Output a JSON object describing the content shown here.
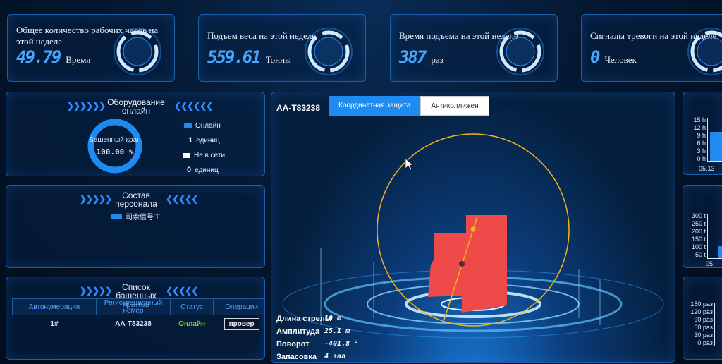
{
  "stats": [
    {
      "title": "Общее количество рабочих часов на этой неделе",
      "value": "49.79",
      "unit": "Время"
    },
    {
      "title": "Подъем веса на этой неделе",
      "value": "559.61",
      "unit": "Тонны"
    },
    {
      "title": "Время подъема на этой неделе",
      "value": "387",
      "unit": "раз"
    },
    {
      "title": "Сигналы тревоги на этой неделе",
      "value": "0",
      "unit": "Человек"
    }
  ],
  "equipment": {
    "title": "Оборудование онлайн",
    "donut_label": "Башенный кран",
    "donut_value": "100.00 %",
    "online_fraction": 1.0,
    "online_label": "Онлайн",
    "online_count": "1",
    "offline_label": "Не в сети",
    "offline_count": "0",
    "unit": "единиц",
    "colors": {
      "online": "#1f8bf0",
      "offline": "#ffffff"
    }
  },
  "personnel": {
    "title": "Состав персонала",
    "items": [
      "司索信号工"
    ]
  },
  "crane_list": {
    "title": "Список башенных кранов",
    "columns": [
      "Автонумерация",
      "Регистрационный номер",
      "Статус",
      "Операции"
    ],
    "rows": [
      {
        "num": "1#",
        "reg": "AA-T83238",
        "status": "Онлайн",
        "action": "провер"
      }
    ]
  },
  "center": {
    "device": "AA-T83238",
    "tabs": [
      "Координатная защита",
      "Антиколлижен"
    ],
    "active_tab": 0,
    "info": [
      {
        "label": "Длина стрелы",
        "value": "10 m"
      },
      {
        "label": "Амплитуда",
        "value": "25.1 m"
      },
      {
        "label": "Поворот",
        "value": "-401.8 °"
      },
      {
        "label": "Запасовка",
        "value": "4 зап"
      }
    ]
  },
  "right_charts": [
    {
      "ticks": [
        "15 h",
        "12 h",
        "9 h",
        "6 h",
        "3 h",
        "0 h"
      ],
      "xlabel": "05.13"
    },
    {
      "ticks": [
        "300 t",
        "250 t",
        "200 t",
        "150 t",
        "100 t",
        "50 t"
      ],
      "xlabel": "05."
    },
    {
      "ticks": [
        "150 paз",
        "120 paз",
        "90 paз",
        "60 paз",
        "30 paз",
        "0 paз"
      ],
      "xlabel": ""
    }
  ]
}
